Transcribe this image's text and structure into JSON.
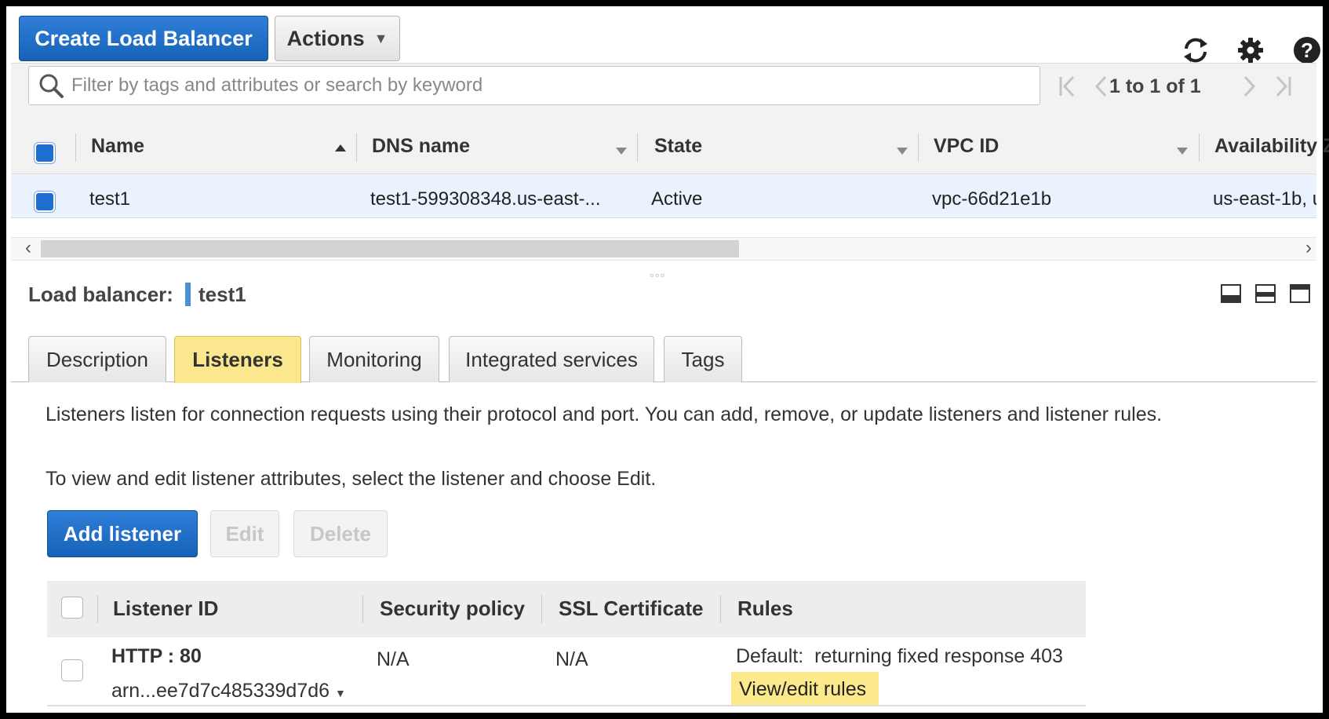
{
  "toolbar": {
    "create_label": "Create Load Balancer",
    "actions_label": "Actions"
  },
  "icons": {
    "refresh": "refresh-icon",
    "settings": "gear-icon",
    "help": "help-icon",
    "search": "search-icon"
  },
  "search": {
    "placeholder": "Filter by tags and attributes or search by keyword",
    "value": ""
  },
  "pagination": {
    "text": "1 to 1 of 1"
  },
  "grid": {
    "columns": [
      "Name",
      "DNS name",
      "State",
      "VPC ID",
      "Availability Z"
    ],
    "rows": [
      {
        "name": "test1",
        "dns": "test1-599308348.us-east-...",
        "state": "Active",
        "vpc": "vpc-66d21e1b",
        "az": "us-east-1b, u"
      }
    ]
  },
  "detail": {
    "label": "Load balancer:",
    "name": "test1"
  },
  "tabs": [
    {
      "label": "Description",
      "active": false
    },
    {
      "label": "Listeners",
      "active": true
    },
    {
      "label": "Monitoring",
      "active": false
    },
    {
      "label": "Integrated services",
      "active": false
    },
    {
      "label": "Tags",
      "active": false
    }
  ],
  "listeners": {
    "intro": "Listeners listen for connection requests using their protocol and port. You can add, remove, or update listeners and listener rules.",
    "hint": "To view and edit listener attributes, select the listener and choose Edit.",
    "add_label": "Add listener",
    "edit_label": "Edit",
    "delete_label": "Delete",
    "columns": [
      "Listener ID",
      "Security policy",
      "SSL Certificate",
      "Rules"
    ],
    "rows": [
      {
        "id": "HTTP : 80",
        "arn": "arn...ee7d7c485339d7d6",
        "policy": "N/A",
        "cert": "N/A",
        "rule_prefix": "Default:",
        "rule_text": "returning fixed response 403",
        "rule_link": "View/edit rules"
      }
    ]
  },
  "colors": {
    "primary": "#1662b8",
    "active_tab": "#fbe88e",
    "selected_row": "#eaf3fd"
  }
}
